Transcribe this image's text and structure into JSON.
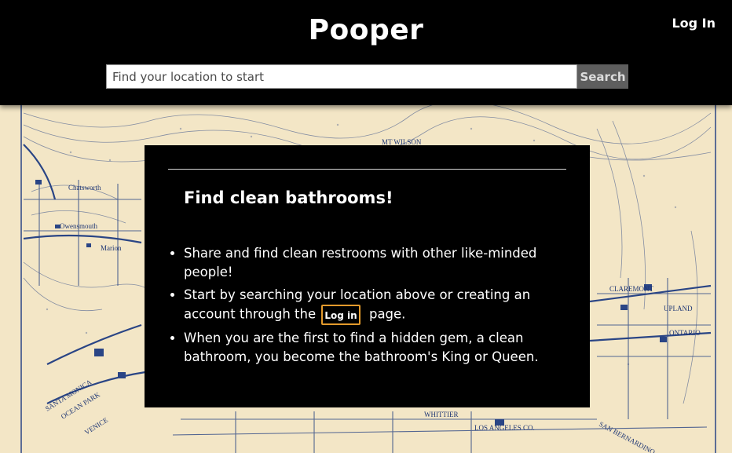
{
  "header": {
    "brand": "Pooper",
    "login_label": "Log In"
  },
  "search": {
    "placeholder": "Find your location to start",
    "value": "",
    "button_label": "Search"
  },
  "card": {
    "title": "Find clean bathrooms!",
    "items": [
      {
        "text": "Share and find clean restrooms with other like-minded people!"
      },
      {
        "text_before": "Start by searching your location above or creating an account through the",
        "link_label": "Log in",
        "text_after": "page."
      },
      {
        "text": "When you are the first to find a hidden gem, a clean bathroom, you become the bathroom's King or Queen."
      }
    ]
  },
  "map": {
    "labels": [
      "MT WILSON",
      "Chatsworth",
      "Owensmouth",
      "Marion",
      "CLAREMONT",
      "UPLAND",
      "ONTARIO",
      "SANTA MONICA",
      "OCEAN PARK",
      "VENICE",
      "WHITTIER",
      "LOS ANGELES CO.",
      "SAN BERNARDINO"
    ],
    "colors": {
      "paper": "#f3e6c6",
      "ink": "#2a4585"
    }
  }
}
